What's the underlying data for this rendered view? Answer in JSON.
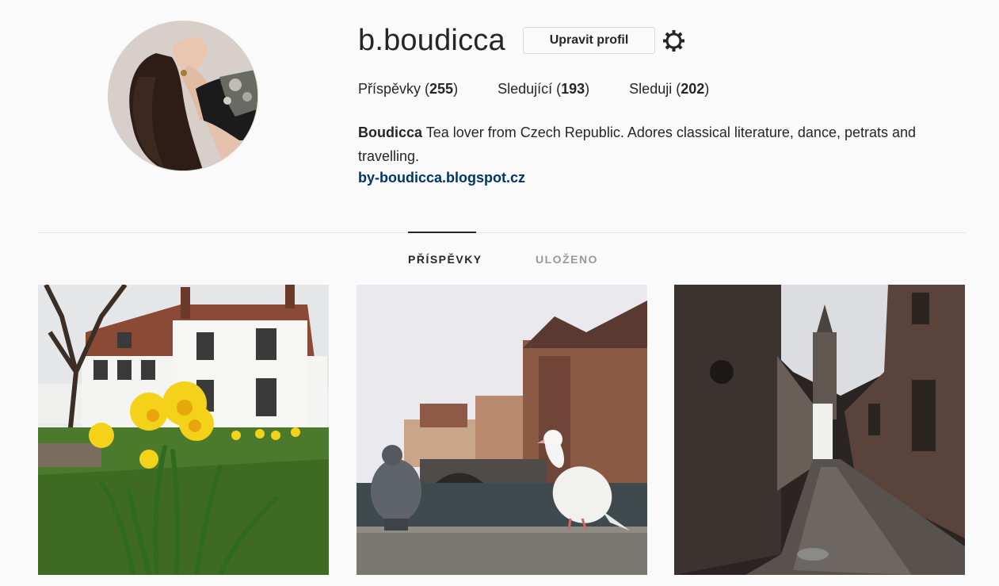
{
  "profile": {
    "username": "b.boudicca",
    "edit_label": "Upravit profil",
    "stats": {
      "posts_label": "Příspěvky",
      "posts_count": "255",
      "followers_label": "Sledující",
      "followers_count": "193",
      "following_label": "Sleduji",
      "following_count": "202"
    },
    "bio_name": "Boudicca",
    "bio_text": "Tea lover from Czech Republic. Adores classical literature, dance, petrats and travelling.",
    "website": "by-boudicca.blogspot.cz"
  },
  "tabs": [
    {
      "label": "PŘÍSPĚVKY",
      "active": true
    },
    {
      "label": "ULOŽENO",
      "active": false
    }
  ],
  "icons": {
    "settings": "gear-icon"
  },
  "posts": [
    {
      "subject": "daffodils"
    },
    {
      "subject": "pigeons-canal"
    },
    {
      "subject": "alley"
    }
  ]
}
